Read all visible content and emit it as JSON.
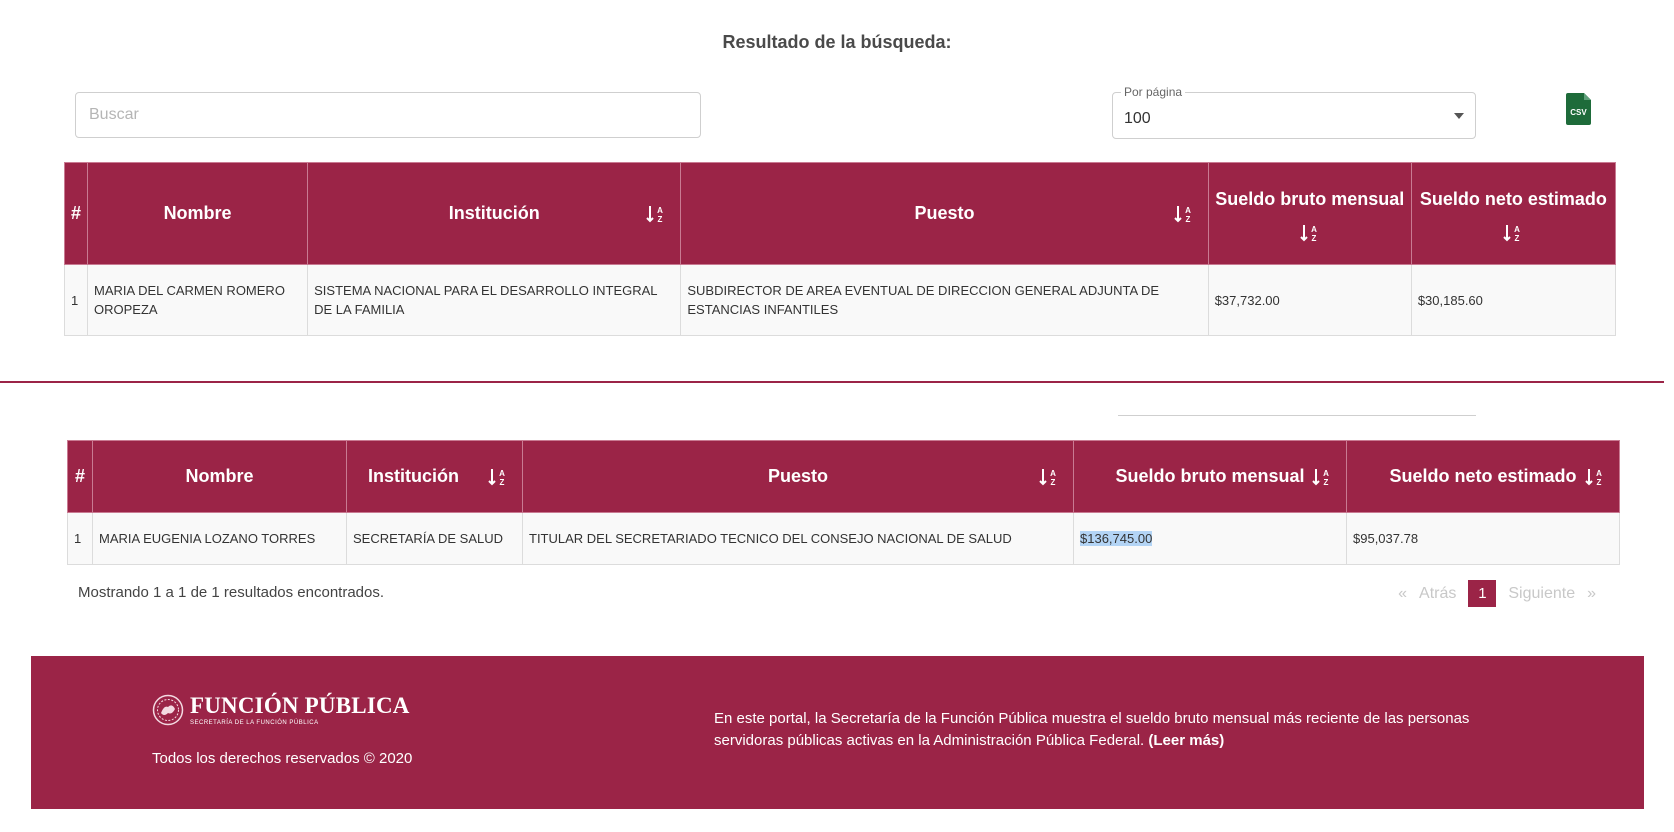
{
  "header": {
    "title": "Resultado de la búsqueda:"
  },
  "search": {
    "placeholder": "Buscar",
    "value": ""
  },
  "per_page": {
    "label": "Por página",
    "value": "100"
  },
  "csv_button": {
    "label": "CSV"
  },
  "table1": {
    "columns": [
      "#",
      "Nombre",
      "Institución",
      "Puesto",
      "Sueldo bruto mensual",
      "Sueldo neto estimado"
    ],
    "rows": [
      [
        "1",
        "MARIA DEL CARMEN ROMERO OROPEZA",
        "SISTEMA NACIONAL PARA EL DESARROLLO INTEGRAL DE LA FAMILIA",
        "SUBDIRECTOR DE AREA EVENTUAL DE DIRECCION GENERAL ADJUNTA DE ESTANCIAS INFANTILES",
        "$37,732.00",
        "$30,185.60"
      ]
    ]
  },
  "table2": {
    "columns": [
      "#",
      "Nombre",
      "Institución",
      "Puesto",
      "Sueldo bruto mensual",
      "Sueldo neto estimado"
    ],
    "rows": [
      [
        "1",
        "MARIA EUGENIA LOZANO TORRES",
        "SECRETARÍA DE SALUD",
        "TITULAR DEL SECRETARIADO TECNICO DEL CONSEJO NACIONAL DE SALUD",
        "$136,745.00",
        "$95,037.78"
      ]
    ],
    "highlighted_cell": "$136,745.00"
  },
  "results_summary": "Mostrando 1 a 1 de 1 resultados encontrados.",
  "pagination": {
    "first": "«",
    "prev": "Atrás",
    "current": "1",
    "next": "Siguiente",
    "last": "»"
  },
  "footer": {
    "logo_text": "FUNCIÓN PÚBLICA",
    "logo_subtext": "SECRETARÍA DE LA FUNCIÓN PÚBLICA",
    "rights": "Todos los derechos reservados © 2020",
    "description": "En este portal, la Secretaría de la Función Pública muestra el sueldo bruto mensual más reciente de las personas servidoras públicas activas en la Administración Pública Federal.",
    "read_more": "(Leer más)"
  },
  "colors": {
    "brand": "#9b2447",
    "csv_green": "#1e6b3a",
    "highlight": "#b3d4f5"
  },
  "icons": {
    "sort": "sort-alpha-icon",
    "csv": "csv-file-icon",
    "caret": "caret-down-icon",
    "seal": "seal-icon"
  }
}
